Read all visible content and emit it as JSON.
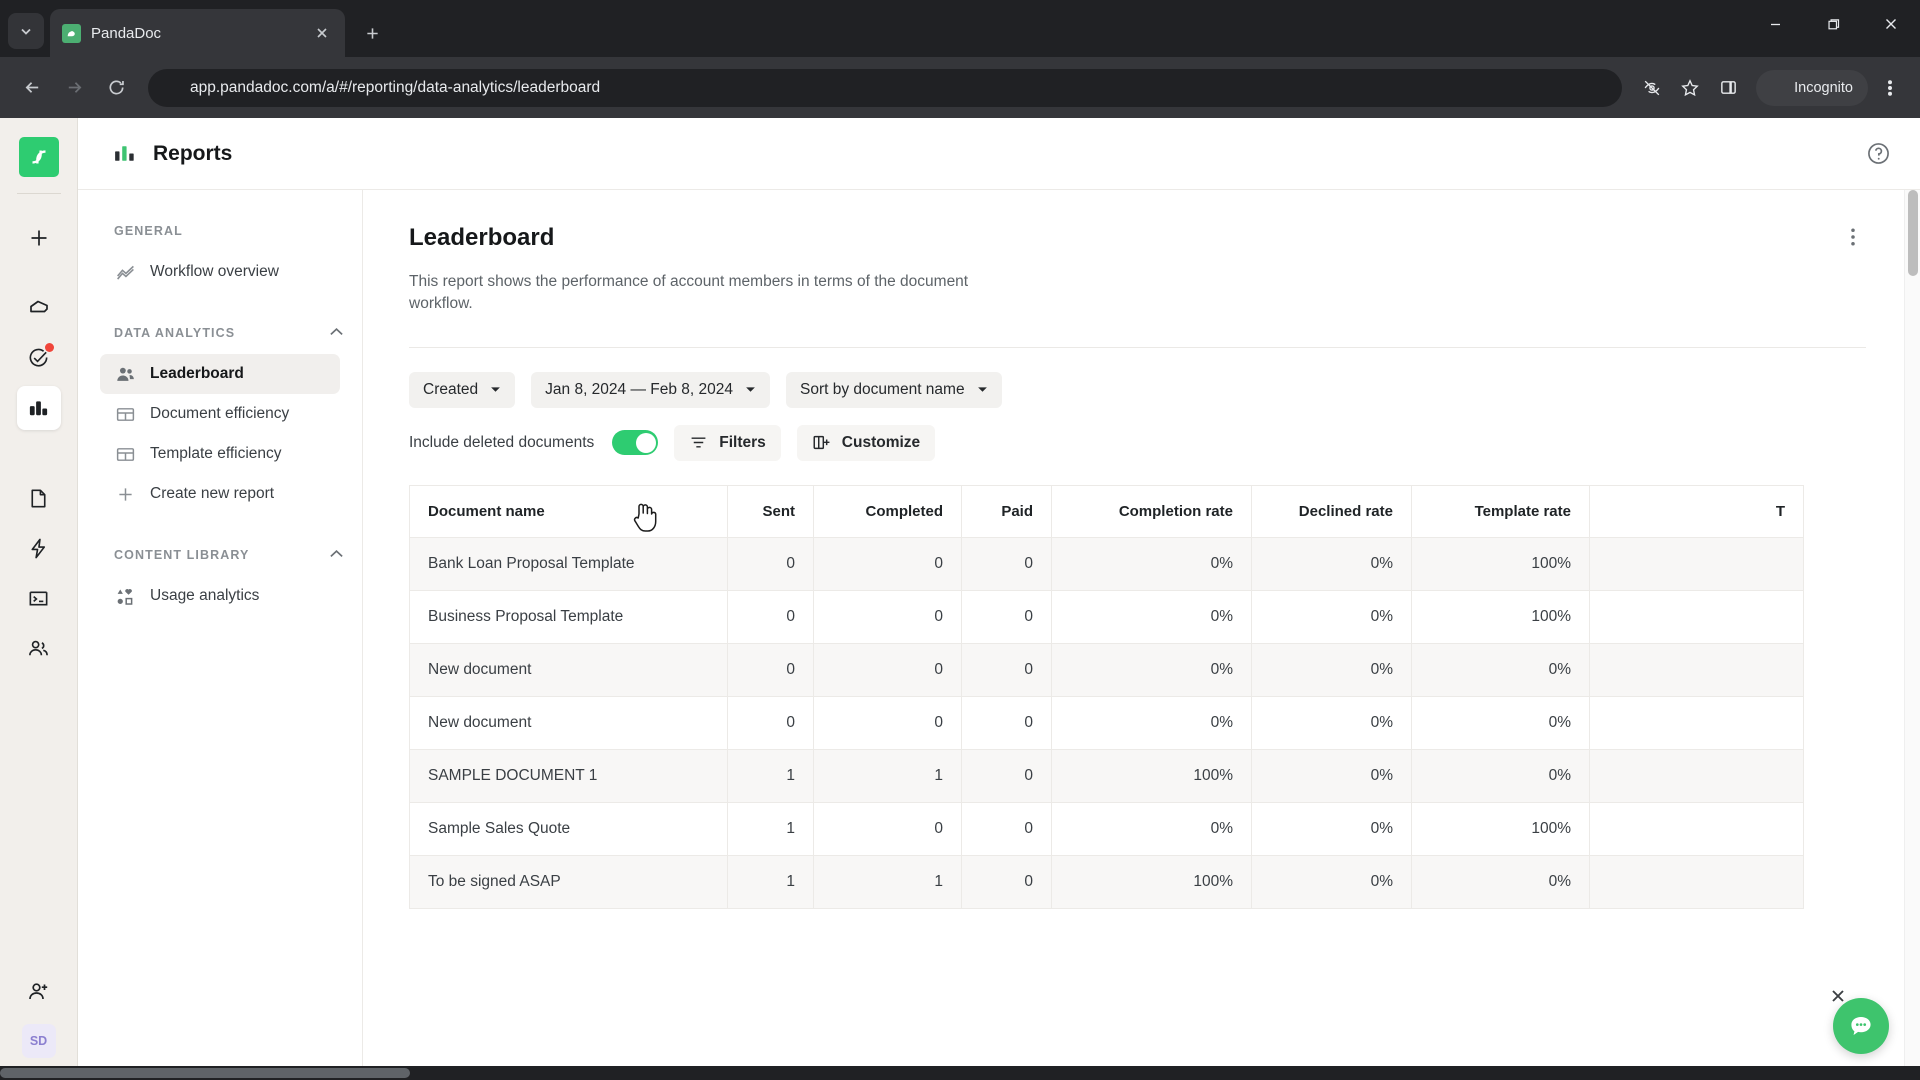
{
  "browser": {
    "tab": {
      "title": "PandaDoc",
      "favicon": "pandadoc-favicon"
    },
    "url": "app.pandadoc.com/a/#/reporting/data-analytics/leaderboard",
    "profile_label": "Incognito",
    "icons": {
      "tab_list": "chevron-down-icon",
      "close_tab": "close-icon",
      "new_tab": "plus-icon",
      "minimize": "minimize-icon",
      "maximize": "maximize-icon",
      "close_window": "close-icon",
      "back": "arrow-left-icon",
      "forward": "arrow-right-icon",
      "reload": "reload-icon",
      "site_info": "site-settings-icon",
      "tracking": "eye-off-icon",
      "bookmark": "star-icon",
      "side_panel": "side-panel-icon",
      "incognito": "incognito-icon",
      "menu": "kebab-menu-icon"
    }
  },
  "rail": {
    "logo": "pandadoc-logo",
    "items": [
      {
        "name": "create-new",
        "icon": "plus-icon",
        "active": false,
        "badge": false
      },
      {
        "name": "home",
        "icon": "home-icon",
        "active": false,
        "badge": false
      },
      {
        "name": "tasks",
        "icon": "check-circle-icon",
        "active": false,
        "badge": true
      },
      {
        "name": "reports",
        "icon": "bar-chart-icon",
        "active": true,
        "badge": false
      },
      {
        "name": "documents",
        "icon": "document-icon",
        "active": false,
        "badge": false
      },
      {
        "name": "quick-actions",
        "icon": "lightning-icon",
        "active": false,
        "badge": false
      },
      {
        "name": "templates",
        "icon": "template-icon",
        "active": false,
        "badge": false
      },
      {
        "name": "contacts",
        "icon": "people-icon",
        "active": false,
        "badge": false
      }
    ],
    "invite_icon": "person-plus-icon",
    "avatar_initials": "SD"
  },
  "header": {
    "icon": "bar-chart-icon",
    "title": "Reports",
    "help_icon": "help-circle-icon"
  },
  "nav": {
    "sections": [
      {
        "label": "GENERAL",
        "collapsible": false,
        "items": [
          {
            "label": "Workflow overview",
            "icon": "trend-line-icon",
            "active": false
          }
        ]
      },
      {
        "label": "DATA ANALYTICS",
        "collapsible": true,
        "caret": "chevron-up-icon",
        "items": [
          {
            "label": "Leaderboard",
            "icon": "people-icon",
            "active": true
          },
          {
            "label": "Document efficiency",
            "icon": "table-icon",
            "active": false
          },
          {
            "label": "Template efficiency",
            "icon": "table-icon",
            "active": false
          },
          {
            "label": "Create new report",
            "icon": "plus-icon",
            "active": false
          }
        ]
      },
      {
        "label": "CONTENT LIBRARY",
        "collapsible": true,
        "caret": "chevron-up-icon",
        "items": [
          {
            "label": "Usage analytics",
            "icon": "shapes-icon",
            "active": false
          }
        ]
      }
    ]
  },
  "report": {
    "title": "Leaderboard",
    "description": "This report shows the performance of account members in terms of the document workflow.",
    "menu_icon": "kebab-menu-icon",
    "filters": {
      "date_field": "Created",
      "date_range": "Jan 8, 2024 — Feb 8, 2024",
      "sort": "Sort by document name",
      "caret_icon": "chevron-down-icon"
    },
    "toolbar": {
      "include_deleted_label": "Include deleted documents",
      "include_deleted_on": true,
      "filters_label": "Filters",
      "filters_icon": "filter-icon",
      "customize_label": "Customize",
      "customize_icon": "customize-columns-icon"
    },
    "table": {
      "columns": [
        "Document name",
        "Sent",
        "Completed",
        "Paid",
        "Completion rate",
        "Declined rate",
        "Template rate",
        "T"
      ],
      "rows": [
        {
          "name": "Bank Loan Proposal Template",
          "sent": "0",
          "completed": "0",
          "paid": "0",
          "completion_rate": "0%",
          "declined_rate": "0%",
          "template_rate": "100%",
          "last": ""
        },
        {
          "name": "Business Proposal Template",
          "sent": "0",
          "completed": "0",
          "paid": "0",
          "completion_rate": "0%",
          "declined_rate": "0%",
          "template_rate": "100%",
          "last": ""
        },
        {
          "name": "New document",
          "sent": "0",
          "completed": "0",
          "paid": "0",
          "completion_rate": "0%",
          "declined_rate": "0%",
          "template_rate": "0%",
          "last": ""
        },
        {
          "name": "New document",
          "sent": "0",
          "completed": "0",
          "paid": "0",
          "completion_rate": "0%",
          "declined_rate": "0%",
          "template_rate": "0%",
          "last": ""
        },
        {
          "name": "SAMPLE DOCUMENT 1",
          "sent": "1",
          "completed": "1",
          "paid": "0",
          "completion_rate": "100%",
          "declined_rate": "0%",
          "template_rate": "0%",
          "last": ""
        },
        {
          "name": "Sample Sales Quote",
          "sent": "1",
          "completed": "0",
          "paid": "0",
          "completion_rate": "0%",
          "declined_rate": "0%",
          "template_rate": "100%",
          "last": ""
        },
        {
          "name": "To be signed ASAP",
          "sent": "1",
          "completed": "1",
          "paid": "0",
          "completion_rate": "100%",
          "declined_rate": "0%",
          "template_rate": "0%",
          "last": ""
        }
      ]
    }
  },
  "chat": {
    "icon": "chat-bubble-icon",
    "close_icon": "close-icon",
    "color": "#3ec46d"
  },
  "colors": {
    "brand_green": "#2ecc71",
    "rail_bg": "#f2efeb",
    "badge_red": "#f0453a",
    "avatar_text": "#8b7fd0"
  }
}
